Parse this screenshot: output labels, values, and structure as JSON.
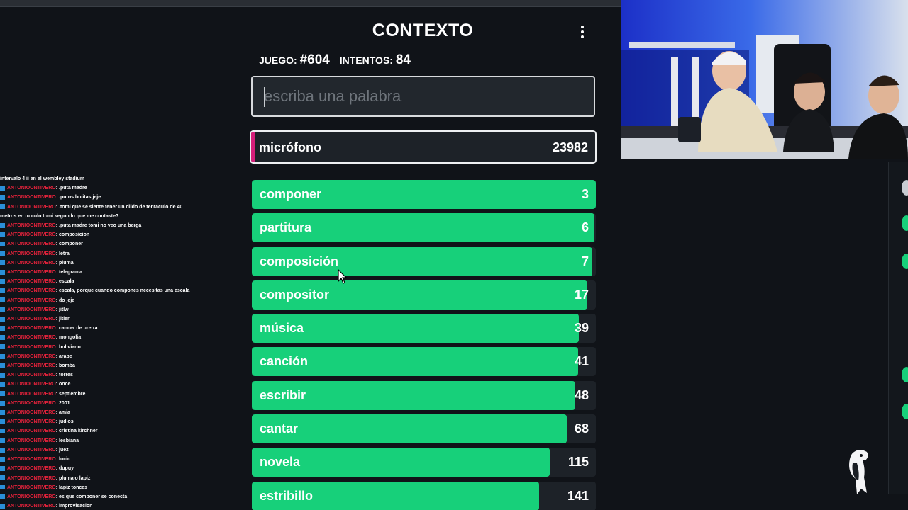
{
  "game": {
    "title": "CONTEXTO",
    "game_label": "JUEGO:",
    "game_number": "#604",
    "attempts_label": "INTENTOS:",
    "attempts_value": "84",
    "search_placeholder": "escriba una palabra",
    "last_guess": {
      "word": "micrófono",
      "rank": "23982"
    },
    "guesses": [
      {
        "word": "componer",
        "rank": "3",
        "fill": 1.0
      },
      {
        "word": "partitura",
        "rank": "6",
        "fill": 0.995
      },
      {
        "word": "composición",
        "rank": "7",
        "fill": 0.99
      },
      {
        "word": "compositor",
        "rank": "17",
        "fill": 0.975
      },
      {
        "word": "música",
        "rank": "39",
        "fill": 0.95
      },
      {
        "word": "canción",
        "rank": "41",
        "fill": 0.948
      },
      {
        "word": "escribir",
        "rank": "48",
        "fill": 0.94
      },
      {
        "word": "cantar",
        "rank": "68",
        "fill": 0.915
      },
      {
        "word": "novela",
        "rank": "115",
        "fill": 0.865
      },
      {
        "word": "estribillo",
        "rank": "141",
        "fill": 0.836
      }
    ]
  },
  "colors": {
    "bar": "#17d07a",
    "last_accent": "#d61e7a"
  },
  "chat": {
    "header": "intervalo 4 ii en el wembley stadium",
    "username": "ANTONIOONTIVERO",
    "messages": [
      ": .puta madre",
      ": .putos bolitas jeje",
      ": .tomi que se siente tener un dildo de tentaculo de 40 metros en tu culo tomi segun lo que me contaste?",
      ": .puta madre tomi no veo una berga",
      ": composicion",
      ": componer",
      ": letra",
      ": pluma",
      ": telegrama",
      ": escala",
      ": escala, porque cuando compones necesitas una escala",
      ": do jeje",
      ": jitlw",
      ": jitler",
      ": cancer de uretra",
      ": mongolia",
      ": boliviano",
      ": arabe",
      ": bomba",
      ": torres",
      ": once",
      ": septiembre",
      ": 2001",
      ": amia",
      ": judios",
      ": cristina kirchner",
      ": lesbiana",
      ": juez",
      ": lucio",
      ": dupuy",
      ": pluma o lapiz",
      ": lapiz tonces",
      ": es que componer se conecta",
      ": improvisacion"
    ]
  }
}
